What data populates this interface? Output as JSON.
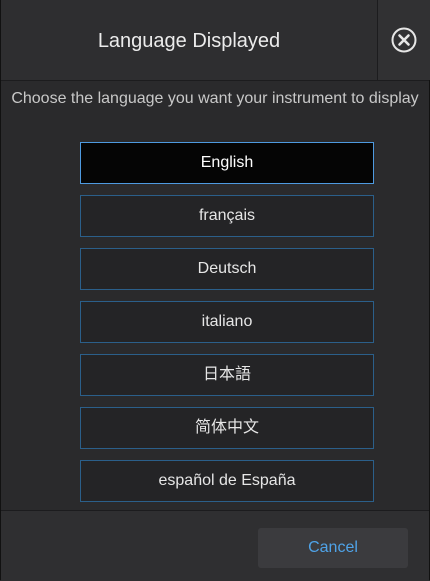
{
  "dialog": {
    "title": "Language Displayed",
    "close_icon": "close-circle-icon",
    "instruction": "Choose the language you want your instrument to display"
  },
  "languages": [
    {
      "label": "English",
      "selected": true
    },
    {
      "label": "français",
      "selected": false
    },
    {
      "label": "Deutsch",
      "selected": false
    },
    {
      "label": "italiano",
      "selected": false
    },
    {
      "label": "日本語",
      "selected": false
    },
    {
      "label": "简体中文",
      "selected": false
    },
    {
      "label": "español de España",
      "selected": false
    }
  ],
  "footer": {
    "cancel_label": "Cancel"
  },
  "colors": {
    "accent": "#4fa3e8",
    "button_border": "#2b5f8a",
    "background": "#2a2a2c"
  }
}
